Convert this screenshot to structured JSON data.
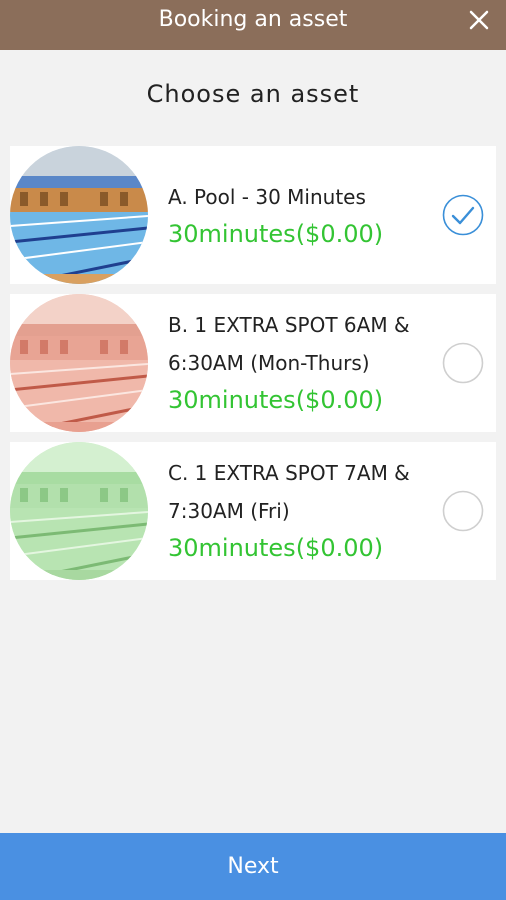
{
  "header": {
    "title": "Booking an asset",
    "close_icon": "close-icon"
  },
  "subtitle": "Choose an asset",
  "assets": [
    {
      "name": "A. Pool - 30 Minutes",
      "price": "30minutes($0.00)",
      "selected": true,
      "tint": "#3a7fd0"
    },
    {
      "name": "B. 1 EXTRA SPOT 6AM &\n6:30AM (Mon-Thurs)",
      "price": "30minutes($0.00)",
      "selected": false,
      "tint": "#e07060"
    },
    {
      "name": "C. 1 EXTRA SPOT 7AM &\n7:30AM (Fri)",
      "price": "30minutes($0.00)",
      "selected": false,
      "tint": "#7fd07f"
    }
  ],
  "footer": {
    "next_label": "Next"
  },
  "colors": {
    "header_bg": "#8b6e5a",
    "price_green": "#33c433",
    "check_blue": "#3a8fd8",
    "next_blue": "#4a90e2"
  }
}
